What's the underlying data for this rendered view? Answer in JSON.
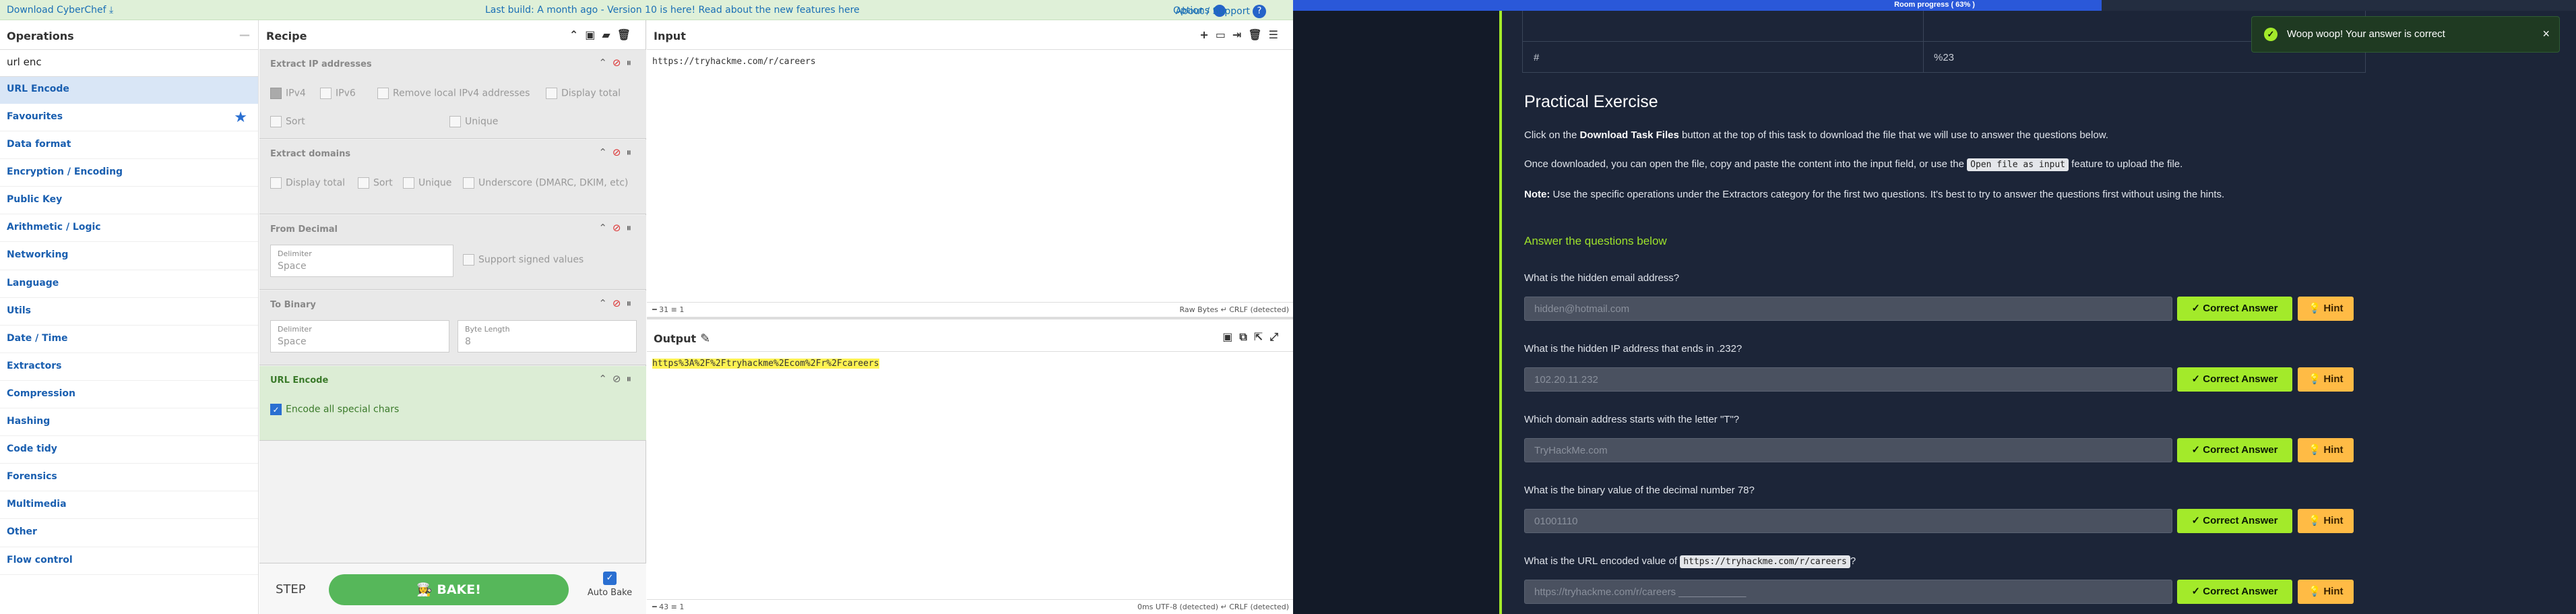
{
  "cyberchef": {
    "topbar": {
      "download": "Download CyberChef",
      "notice": "Last build: A month ago - Version 10 is here! Read about the new features here",
      "options": "Options",
      "about": "About / Support"
    },
    "operations": {
      "title": "Operations",
      "search_value": "url enc",
      "match": "URL Encode",
      "categories": [
        "Favourites",
        "Data format",
        "Encryption / Encoding",
        "Public Key",
        "Arithmetic / Logic",
        "Networking",
        "Language",
        "Utils",
        "Date / Time",
        "Extractors",
        "Compression",
        "Hashing",
        "Code tidy",
        "Forensics",
        "Multimedia",
        "Other",
        "Flow control"
      ]
    },
    "recipe": {
      "title": "Recipe",
      "ops": {
        "extract_ip": {
          "title": "Extract IP addresses",
          "opts": [
            "IPv4",
            "IPv6",
            "Remove local IPv4 addresses",
            "Display total",
            "Sort",
            "Unique"
          ]
        },
        "extract_domains": {
          "title": "Extract domains",
          "opts": [
            "Display total",
            "Sort",
            "Unique",
            "Underscore (DMARC, DKIM, etc)"
          ]
        },
        "from_decimal": {
          "title": "From Decimal",
          "delim_label": "Delimiter",
          "delim_value": "Space",
          "signed": "Support signed values"
        },
        "to_binary": {
          "title": "To Binary",
          "delim_label": "Delimiter",
          "delim_value": "Space",
          "byte_label": "Byte Length",
          "byte_value": "8"
        },
        "url_encode": {
          "title": "URL Encode",
          "opt": "Encode all special chars"
        }
      },
      "step": "STEP",
      "bake": "BAKE!",
      "auto_bake": "Auto Bake"
    },
    "input": {
      "title": "Input",
      "text": "https://tryhackme.com/r/careers",
      "status_left": "━ 31   ≡ 1",
      "status_right": "Raw Bytes   ↵ CRLF (detected)"
    },
    "output": {
      "title": "Output",
      "text": "https%3A%2F%2Ftryhackme%2Ecom%2Fr%2Fcareers",
      "status_left": "━ 43   ≡ 1",
      "status_right": "0ms   UTF-8 (detected)   ↵ CRLF (detected)"
    }
  },
  "tryhackme": {
    "progress": {
      "label": "Room progress ( 63% )",
      "percent": 63
    },
    "table_tail": {
      "row1": [
        "",
        ""
      ],
      "row2": [
        "#",
        "%23"
      ]
    },
    "section_title": "Practical Exercise",
    "p1_a": "Click on the ",
    "p1_b": "Download Task Files",
    "p1_c": " button at the top of this task to download the file that we will use to answer the questions below.",
    "p2_a": "Once downloaded, you can open the file, copy and paste the content into the input field, or use the ",
    "p2_code": "Open file as input",
    "p2_c": " feature to upload the file.",
    "p3_a": "Note:",
    "p3_b": " Use the specific operations under the Extractors category for the first two questions. It's best to try to answer the questions first without using the hints.",
    "answers_head": "Answer the questions below",
    "questions": [
      {
        "q": "What is the hidden email address?",
        "a": "hidden@hotmail.com"
      },
      {
        "q": "What is the hidden IP address that ends in .232?",
        "a": "102.20.11.232"
      },
      {
        "q": "Which domain address starts with the letter \"T\"?",
        "a": "TryHackMe.com"
      },
      {
        "q": "What is the binary value of the decimal number 78?",
        "a": "01001110"
      },
      {
        "q_a": "What is the URL encoded value of ",
        "q_code": "https://tryhackme.com/r/careers",
        "q_c": "?",
        "a": "https://tryhackme.com/r/careers ____________"
      }
    ],
    "correct_label": "Correct Answer",
    "hint_label": "Hint",
    "toast": "Woop woop! Your answer is correct"
  }
}
